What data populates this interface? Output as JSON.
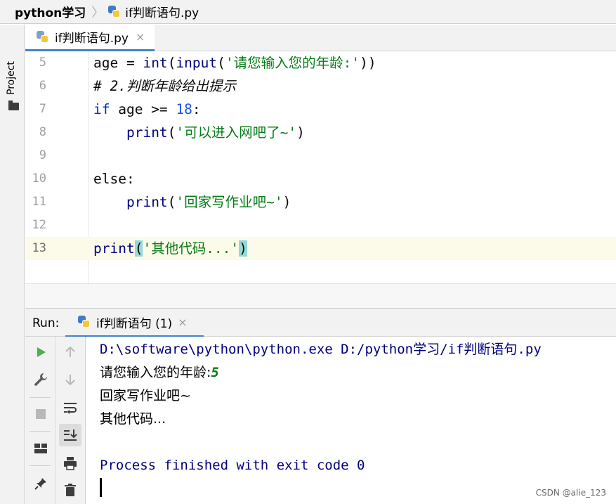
{
  "breadcrumb": {
    "project": "python学习",
    "separator": "〉",
    "file": "if判断语句.py"
  },
  "left_strip": {
    "project_label": "Project"
  },
  "editor_tab": {
    "label": "if判断语句.py",
    "close": "×"
  },
  "editor": {
    "lines": [
      {
        "num": "5",
        "code": "age = int(input('请您输入您的年龄:'))"
      },
      {
        "num": "6",
        "code": "# 2.判断年龄给出提示"
      },
      {
        "num": "7",
        "code": "if age >= 18:"
      },
      {
        "num": "8",
        "code": "    print('可以进入网吧了~')"
      },
      {
        "num": "9",
        "code": ""
      },
      {
        "num": "10",
        "code": "else:"
      },
      {
        "num": "11",
        "code": "    print('回家写作业吧~')"
      },
      {
        "num": "12",
        "code": ""
      },
      {
        "num": "13",
        "code": "print('其他代码...')"
      }
    ],
    "current_line": "13"
  },
  "run_panel": {
    "label": "Run:",
    "tab_label": "if判断语句 (1)",
    "tab_close": "×",
    "toolbar_icons": [
      "run-icon",
      "wrench-icon",
      "stop-icon",
      "layout-icon",
      "pin-icon",
      "up-arrow-icon",
      "down-arrow-icon",
      "soft-wrap-icon",
      "scroll-to-end-icon",
      "print-icon",
      "trash-icon"
    ]
  },
  "console": {
    "command": "D:\\software\\python\\python.exe D:/python学习/if判断语句.py",
    "prompt": "请您输入您的年龄:",
    "input_value": "5",
    "output_1": "回家写作业吧~",
    "output_2": "其他代码...",
    "exit_message": "Process finished with exit code 0"
  },
  "watermark": "CSDN @alie_123",
  "colors": {
    "keyword": "#0033b3",
    "builtin": "#000080",
    "string": "#067d17",
    "number": "#1750eb",
    "comment": "#8c8c8c",
    "accent": "#4083c9",
    "run_green": "#4caf50"
  }
}
